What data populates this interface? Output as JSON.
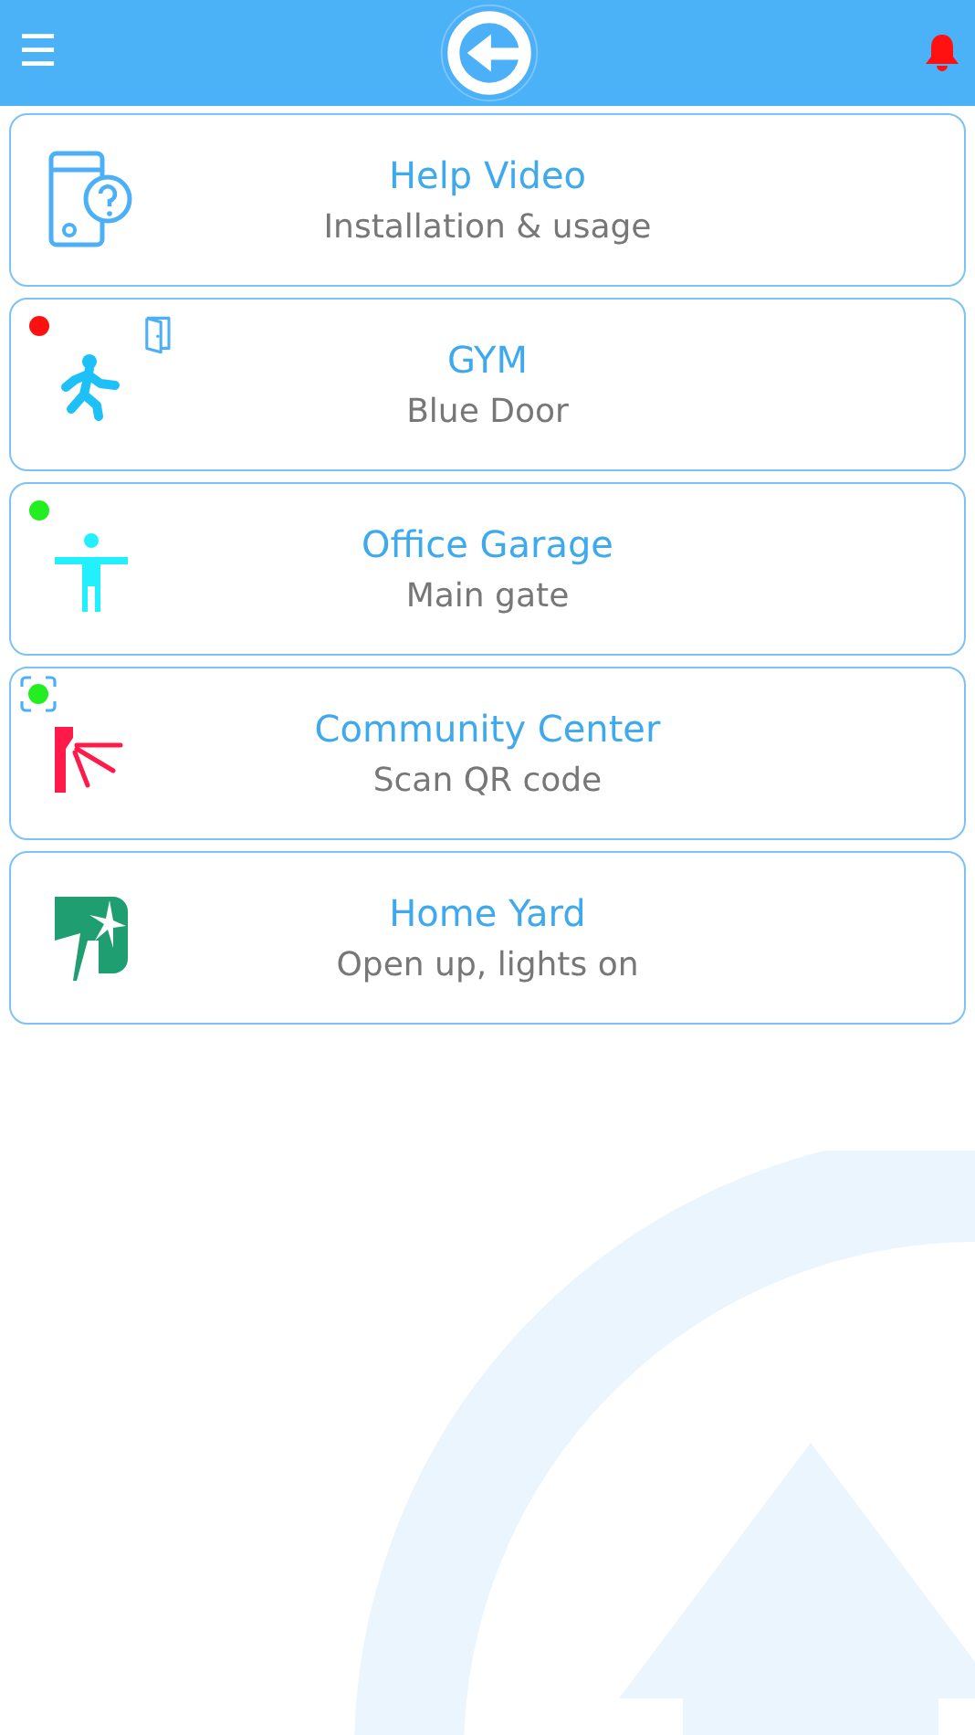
{
  "header": {
    "menu_glyph": "☰"
  },
  "items": [
    {
      "kind": "help",
      "title": "Help Video",
      "subtitle": "Installation & usage"
    },
    {
      "kind": "door",
      "title": "GYM",
      "subtitle": "Blue Door",
      "color": "#ff1010"
    },
    {
      "kind": "gate",
      "title": "Office Garage",
      "subtitle": "Main gate",
      "color": "#22ee22"
    },
    {
      "kind": "qr",
      "title": "Community Center",
      "subtitle": "Scan QR code",
      "color": "#22ee22"
    },
    {
      "kind": "yard",
      "title": "Home Yard",
      "subtitle": "Open up, lights on"
    }
  ]
}
